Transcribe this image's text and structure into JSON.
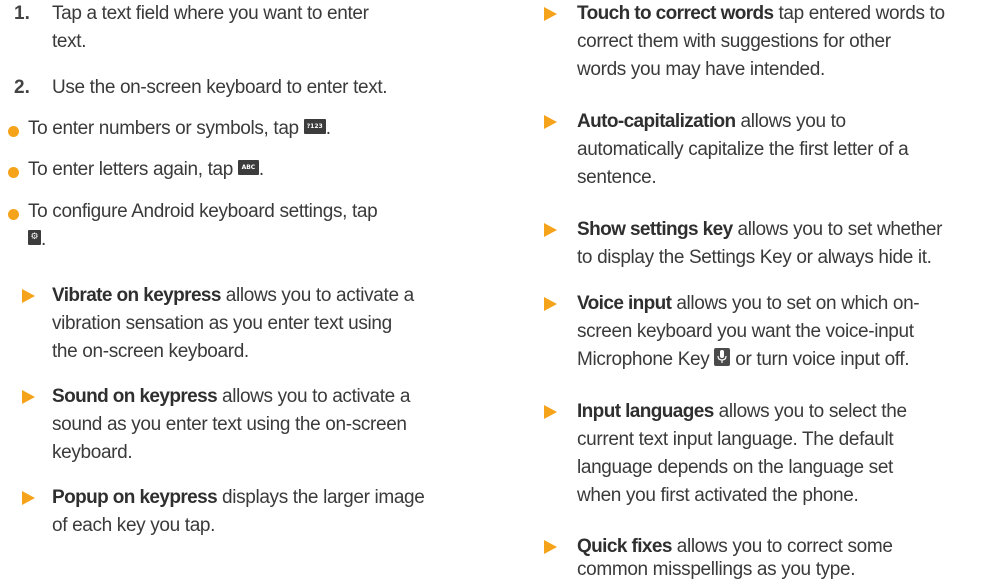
{
  "steps": [
    {
      "number": "1.",
      "text_a": "Tap a text field where you want to enter",
      "text_b": "text."
    },
    {
      "number": "2.",
      "text": "Use the on-screen keyboard to enter text."
    }
  ],
  "bullets": [
    {
      "text": "To enter numbers or symbols, tap",
      "key": "?123",
      "after": "."
    },
    {
      "text": "To enter letters again, tap",
      "key": "ABC",
      "after": "."
    },
    {
      "text": "To configure Android keyboard settings, tap",
      "key_icon": "gear-icon",
      "after": "."
    }
  ],
  "settings_left": [
    {
      "term": "Vibrate on keypress",
      "lines": [
        " allows you to activate a",
        "vibration sensation as you enter text using",
        "the on-screen keyboard."
      ]
    },
    {
      "term": "Sound on keypress",
      "lines": [
        " allows you to activate a",
        "sound as you enter text using the on-screen",
        "keyboard."
      ]
    },
    {
      "term": "Popup on keypress",
      "lines": [
        " displays the larger image",
        "of each key you tap."
      ]
    }
  ],
  "settings_right": [
    {
      "term": "Touch to correct words",
      "lines": [
        " tap entered words to",
        "correct them with suggestions for other",
        "words you may have intended."
      ]
    },
    {
      "term": "Auto-capitalization",
      "lines": [
        " allows you to",
        "automatically capitalize the first letter of a",
        "sentence."
      ]
    },
    {
      "term": "Show settings key",
      "lines": [
        " allows you to set whether",
        "to display the Settings Key or always hide it."
      ]
    },
    {
      "term": "Voice input",
      "lines": [
        " allows you to set on which on-",
        "screen keyboard you want the voice-input",
        "Microphone Key",
        " or turn voice input off."
      ],
      "icon": "microphone-icon"
    },
    {
      "term": "Input languages",
      "lines": [
        " allows you to select the",
        "current text input language. The default",
        "language depends on the language set",
        "when you first activated the phone."
      ]
    },
    {
      "term": "Quick fixes",
      "lines": [
        " allows you to correct some",
        "common misspellings as you type."
      ]
    }
  ],
  "colors": {
    "accent": "#f5a31a",
    "text": "#3a3a3a",
    "key": "#3c3c3c"
  }
}
